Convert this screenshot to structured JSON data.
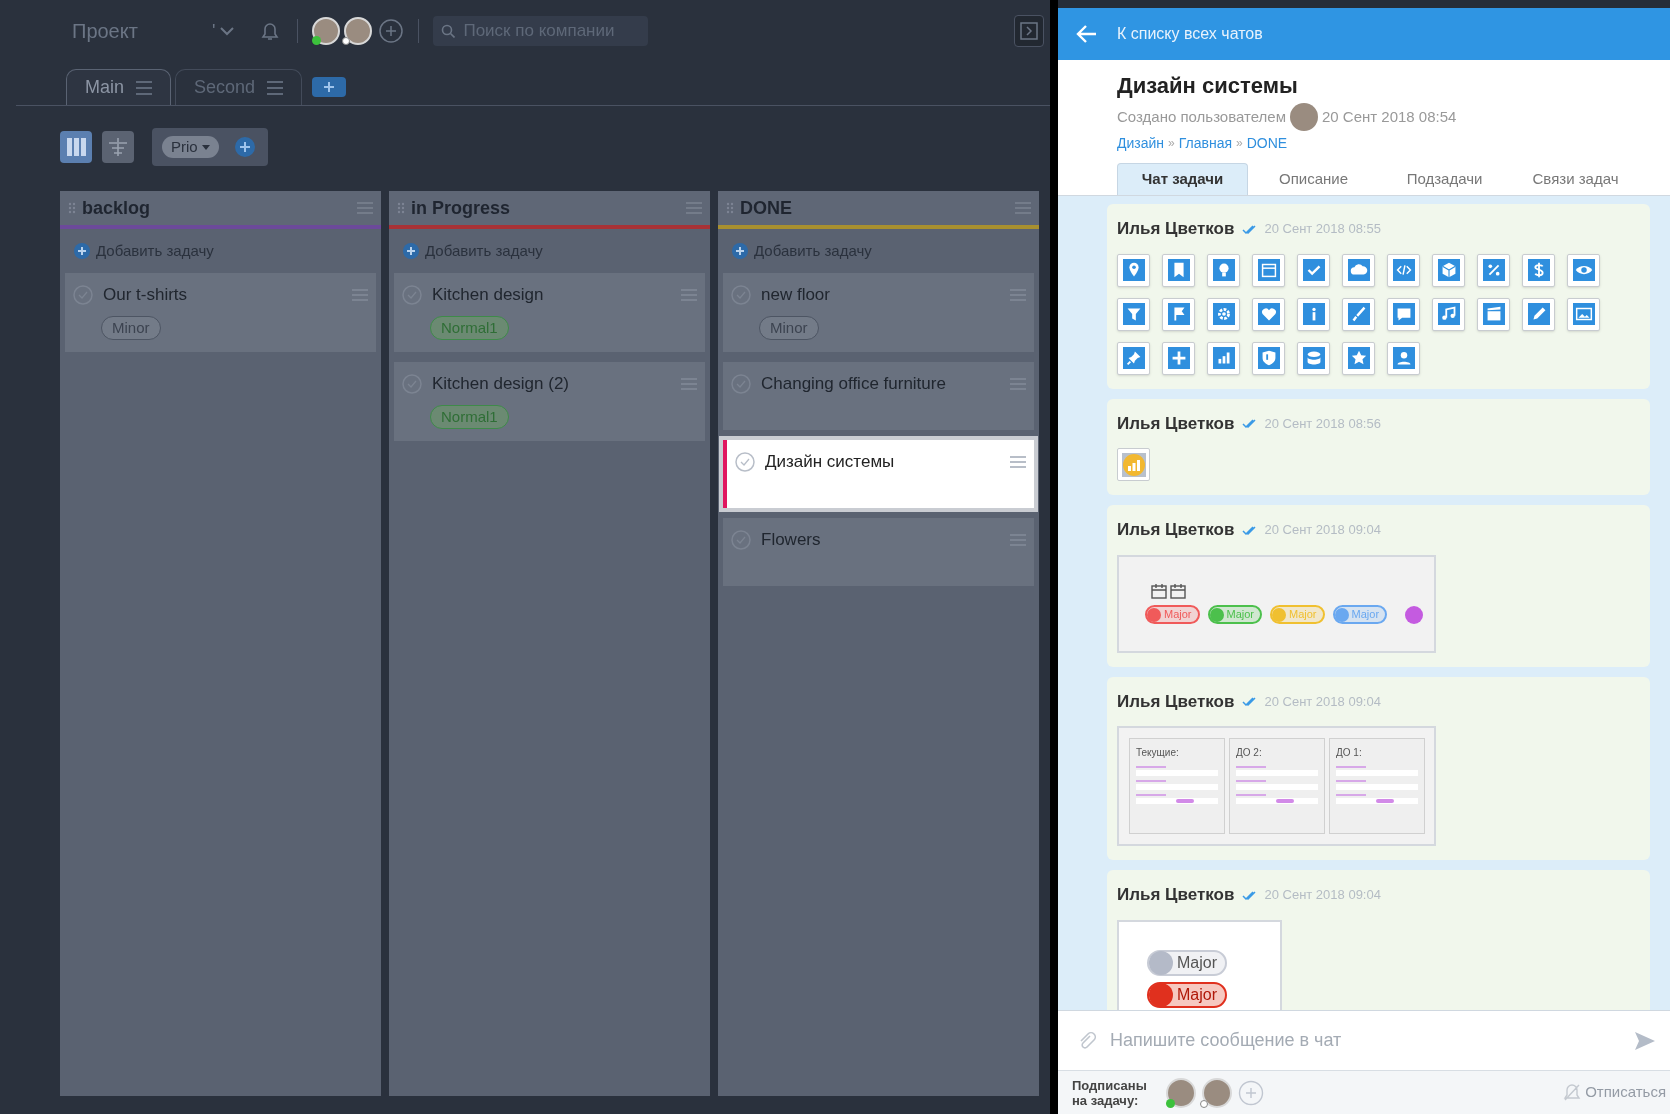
{
  "header": {
    "project": "Проект",
    "project_mark": "'",
    "members": [
      {
        "online": true
      },
      {
        "online": false
      }
    ],
    "search": {
      "placeholder": "Поиск по компании"
    }
  },
  "tabs": [
    {
      "label": "Main",
      "selected": true
    },
    {
      "label": "Second",
      "selected": false
    }
  ],
  "toolbar": {
    "views": [
      {
        "kind": "board",
        "selected": true
      },
      {
        "kind": "tree",
        "selected": false
      }
    ],
    "group": "Prio"
  },
  "columns": [
    {
      "title": "backlog",
      "color": "#6c4a9a",
      "add_label": "Добавить задачу",
      "cards": [
        {
          "title": "Our t-shirts",
          "selected": false,
          "tag": {
            "label": "Minor",
            "kind": "minor"
          }
        }
      ]
    },
    {
      "title": "in Progress",
      "color": "#a83236",
      "add_label": "Добавить задачу",
      "cards": [
        {
          "title": "Kitchen design",
          "selected": false,
          "tag": {
            "label": "Normal1",
            "kind": "normal"
          }
        },
        {
          "title": "Kitchen design (2)",
          "selected": false,
          "tag": {
            "label": "Normal1",
            "kind": "normal"
          }
        }
      ]
    },
    {
      "title": "DONE",
      "color": "#a89030",
      "add_label": "Добавить задачу",
      "cards": [
        {
          "title": "new floor",
          "selected": false,
          "tag": {
            "label": "Minor",
            "kind": "minor"
          }
        },
        {
          "title": "Changing office furniture",
          "selected": false
        },
        {
          "title": "Дизайн системы",
          "selected": true
        },
        {
          "title": "Flowers",
          "selected": false
        }
      ]
    }
  ],
  "chat_panel": {
    "back_label": "К списку всех чатов",
    "title": "Дизайн системы",
    "created_label": "Создано пользователем",
    "created_at": "20 Сент 2018 08:54",
    "breadcrumb": [
      {
        "kind": "link",
        "text": "Дизайн"
      },
      {
        "kind": "separator",
        "text": "»"
      },
      {
        "kind": "link",
        "text": "Главная"
      },
      {
        "kind": "separator",
        "text": "»"
      },
      {
        "kind": "link",
        "text": "DONE"
      }
    ],
    "tabs": [
      {
        "label": "Чат задачи",
        "selected": true
      },
      {
        "label": "Описание",
        "selected": false
      },
      {
        "label": "Подзадачи",
        "selected": false
      },
      {
        "label": "Связи задач",
        "selected": false
      }
    ],
    "messages": [
      {
        "author": "Илья Цветков",
        "time": "20 Сент 2018 08:55",
        "attachment": {
          "kind": "icon_grid"
        }
      },
      {
        "author": "Илья Цветков",
        "time": "20 Сент 2018 08:56",
        "attachment": {
          "kind": "chart_icon"
        }
      },
      {
        "author": "Илья Цветков",
        "time": "20 Сент 2018 09:04",
        "attachment": {
          "kind": "tags_image",
          "tags": [
            {
              "kind": "pill",
              "label": "Major",
              "color": "#f05a5a"
            },
            {
              "kind": "pill",
              "label": "Major",
              "color": "#4cc04c"
            },
            {
              "kind": "pill",
              "label": "Major",
              "color": "#f0c030"
            },
            {
              "kind": "pill",
              "label": "Major",
              "color": "#6aa8f0"
            },
            {
              "kind": "dot",
              "color": "#c45be0"
            }
          ]
        }
      },
      {
        "author": "Илья Цветков",
        "time": "20 Сент 2018 09:04",
        "attachment": {
          "kind": "columns_image",
          "panels": [
            {
              "title": "Текущие:"
            },
            {
              "title": "ДО 2:"
            },
            {
              "title": "ДО 1:"
            }
          ]
        }
      },
      {
        "author": "Илья Цветков",
        "time": "20 Сент 2018 09:04",
        "attachment": {
          "kind": "toggles_image",
          "toggles": [
            {
              "label": "Major",
              "on": false
            },
            {
              "label": "Major",
              "on": true
            }
          ]
        }
      }
    ],
    "composer": {
      "placeholder": "Напишите сообщение в чат"
    },
    "subscribers": {
      "label": "Подписаны на задачу:",
      "members": [
        {
          "online": true
        },
        {
          "online": false
        }
      ],
      "unsubscribe": "Отписаться"
    }
  }
}
